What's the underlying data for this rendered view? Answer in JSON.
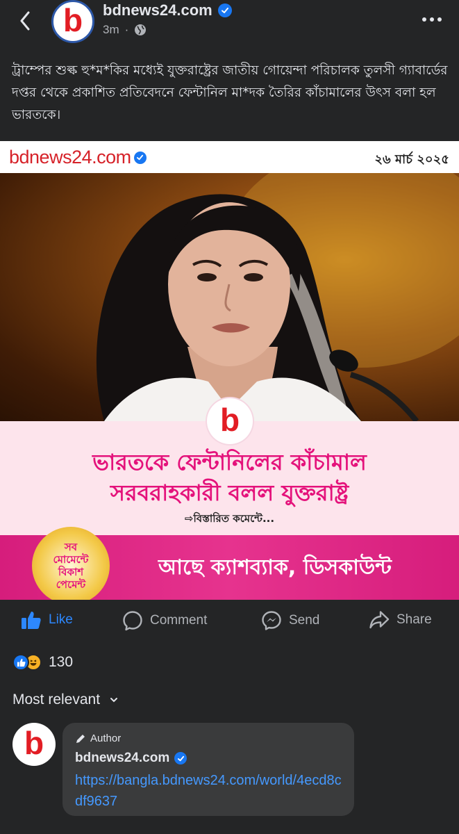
{
  "header": {
    "page_name": "bdnews24.com",
    "time": "3m",
    "avatar_letter": "b",
    "icons": [
      "back-arrow-icon",
      "verified-badge-icon",
      "globe-icon",
      "more-horizontal-icon"
    ]
  },
  "post": {
    "caption": "ট্রাম্পের শুল্ক হু*ম*কির মধ্যেই যুক্তরাষ্ট্রের জাতীয় গোয়েন্দা পরিচালক তুলসী গ্যাবার্ডের দপ্তর থেকে প্রকাশিত প্রতিবেদনে ফেন্টানিল মা*দক তৈরির কাঁচামালের উৎস বলা হল ভারতকে।"
  },
  "card": {
    "brand": "bdnews24.com",
    "date": "২৬ মার্চ ২০২৫",
    "logo_letter": "b",
    "headline_line1": "ভারতকে ফেন্টানিলের কাঁচামাল",
    "headline_line2": "সরবরাহকারী বলল যুক্তরাষ্ট্র",
    "details": "⇨বিস্তারিত কমেন্টে...",
    "promo_badge_line1": "সব",
    "promo_badge_line2": "মোমেন্টে",
    "promo_badge_line3": "বিকাশ",
    "promo_badge_line4": "পেমেন্ট",
    "promo_text": "আছে ক্যাশব্যাক, ডিসকাউন্ট"
  },
  "actions": {
    "like": "Like",
    "comment": "Comment",
    "send": "Send",
    "share": "Share"
  },
  "reactions": {
    "count": "130"
  },
  "comments": {
    "sort_label": "Most relevant",
    "items": [
      {
        "author_tag": "Author",
        "name": "bdnews24.com",
        "avatar_letter": "b",
        "link": "https://bangla.bdnews24.com/world/4ecd8cdf9637"
      }
    ]
  },
  "colors": {
    "background": "#242526",
    "accent": "#2d88ff",
    "headline": "#e4127b",
    "brand_red": "#e21d24"
  }
}
